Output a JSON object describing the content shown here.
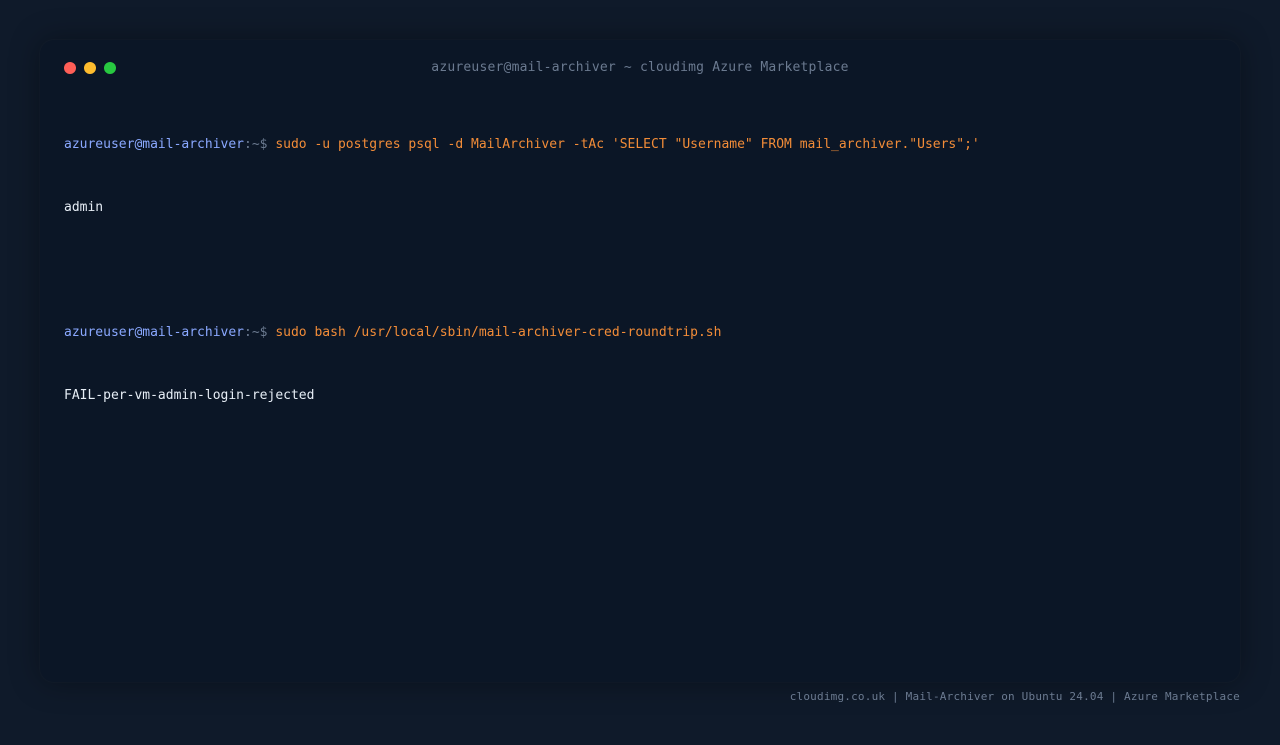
{
  "window": {
    "title": "azureuser@mail-archiver ~ cloudimg Azure Marketplace"
  },
  "colors": {
    "background": "#0f1a2a",
    "terminal": "#0b1626",
    "prompt": "#8aa8ff",
    "command": "#f28c38",
    "output": "#e6edf5",
    "muted": "#6b7a90"
  },
  "terminal": {
    "entries": [
      {
        "prompt_user": "azureuser@mail-archiver",
        "prompt_sep": ":~$",
        "command": "sudo -u postgres psql -d MailArchiver -tAc 'SELECT \"Username\" FROM mail_archiver.\"Users\";'",
        "output": "admin"
      },
      {
        "prompt_user": "azureuser@mail-archiver",
        "prompt_sep": ":~$",
        "command": "sudo bash /usr/local/sbin/mail-archiver-cred-roundtrip.sh",
        "output": "FAIL-per-vm-admin-login-rejected"
      }
    ]
  },
  "footer": {
    "text": "cloudimg.co.uk | Mail-Archiver on Ubuntu 24.04 | Azure Marketplace"
  }
}
